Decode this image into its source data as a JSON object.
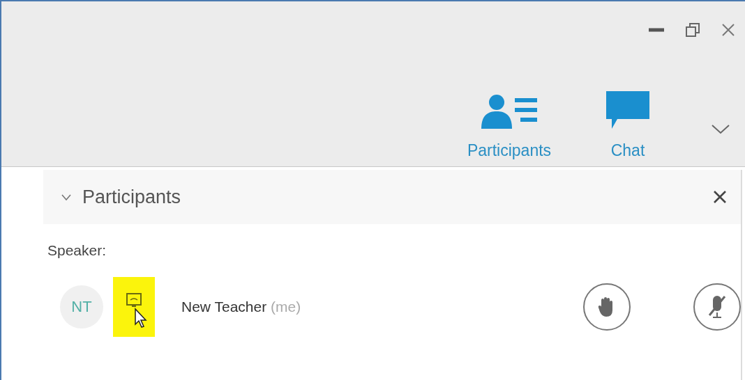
{
  "toolbar": {
    "tabs": [
      {
        "label": "Participants",
        "kind": "participants"
      },
      {
        "label": "Chat",
        "kind": "chat"
      }
    ]
  },
  "panel": {
    "title": "Participants",
    "expanded": true,
    "section_label": "Speaker:",
    "participants": [
      {
        "initials": "NT",
        "name": "New Teacher",
        "suffix": "(me)",
        "device_highlighted": true,
        "muted": true
      }
    ]
  }
}
